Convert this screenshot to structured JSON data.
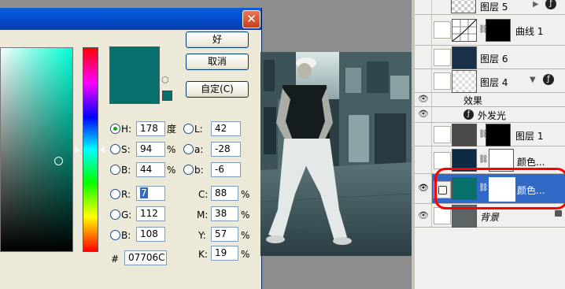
{
  "dialog": {
    "close_glyph": "✕",
    "buttons": {
      "ok": "好",
      "cancel": "取消",
      "custom": "自定(C)"
    },
    "hsb": [
      {
        "label": "H:",
        "value": "178",
        "unit": "度",
        "selected": true
      },
      {
        "label": "S:",
        "value": "94",
        "unit": "%",
        "selected": false
      },
      {
        "label": "B:",
        "value": "44",
        "unit": "%",
        "selected": false
      }
    ],
    "lab": [
      {
        "label": "L:",
        "value": "42"
      },
      {
        "label": "a:",
        "value": "-28"
      },
      {
        "label": "b:",
        "value": "-6"
      }
    ],
    "rgb": [
      {
        "label": "R:",
        "value": "7"
      },
      {
        "label": "G:",
        "value": "112"
      },
      {
        "label": "B:",
        "value": "108"
      }
    ],
    "cmyk": [
      {
        "label": "C:",
        "value": "88",
        "unit": "%"
      },
      {
        "label": "M:",
        "value": "38",
        "unit": "%"
      },
      {
        "label": "Y:",
        "value": "57",
        "unit": "%"
      },
      {
        "label": "K:",
        "value": "19",
        "unit": "%"
      }
    ],
    "hex_label": "#",
    "hex_value": "07706C",
    "current_color": "#07706c",
    "icons": {
      "cube": "cube-icon",
      "close": "close-icon"
    }
  },
  "layers": {
    "items": [
      {
        "name": "图层 5",
        "visible": false
      },
      {
        "name": "曲线 1",
        "visible": false
      },
      {
        "name": "图层 6",
        "visible": false
      },
      {
        "name": "图层 4",
        "visible": false
      },
      {
        "name": "效果",
        "visible": true
      },
      {
        "name": "外发光",
        "visible": true
      },
      {
        "name": "图层 1",
        "visible": false
      },
      {
        "name": "颜色...",
        "visible": false
      },
      {
        "name": "颜色...",
        "visible": true,
        "selected": true
      },
      {
        "name": "背景",
        "visible": true
      }
    ],
    "fx_glyph": "ƒ"
  }
}
